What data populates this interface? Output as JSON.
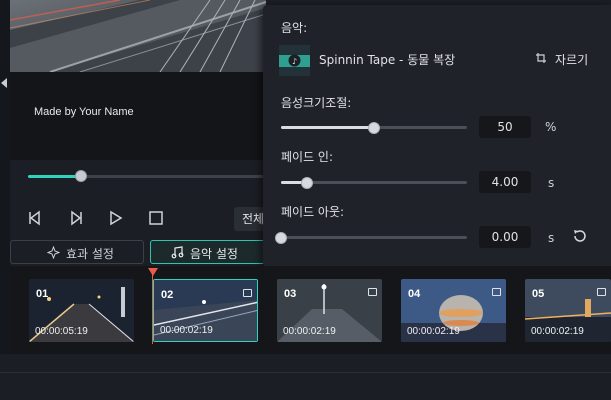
{
  "preview": {
    "watermark_text": "Made by Your Name"
  },
  "playback": {
    "progress": 0.22,
    "fullscreen_label": "전체"
  },
  "tabs": {
    "effects_label": "효과 설정",
    "music_label": "음악 설정"
  },
  "audio_panel": {
    "music_heading": "음악:",
    "track_name": "Spinnin Tape - 동물 복장",
    "cut_label": "자르기",
    "volume": {
      "label": "음성크기조절:",
      "value": "50",
      "unit": "%",
      "level": 0.5
    },
    "fade_in": {
      "label": "페이드 인:",
      "value": "4.00",
      "unit": "s",
      "level": 0.14
    },
    "fade_out": {
      "label": "페이드 아웃:",
      "value": "0.00",
      "unit": "s",
      "level": 0.0
    }
  },
  "timeline": {
    "clips": [
      {
        "number": "01",
        "time": "00:00:05:19"
      },
      {
        "number": "02",
        "time": "00:00:02:19"
      },
      {
        "number": "03",
        "time": "00:00:02:19"
      },
      {
        "number": "04",
        "time": "00:00:02:19"
      },
      {
        "number": "05",
        "time": "00:00:02:19"
      }
    ]
  },
  "colors": {
    "accent": "#31d3bd",
    "playhead": "#e85c4a",
    "panel_bg": "#1f2228"
  },
  "icons": [
    "chevron-left-icon",
    "prev-frame-icon",
    "next-frame-icon",
    "play-icon",
    "stop-icon",
    "sparkle-icon",
    "music-note-icon",
    "crop-icon",
    "reset-icon",
    "picture-icon"
  ]
}
